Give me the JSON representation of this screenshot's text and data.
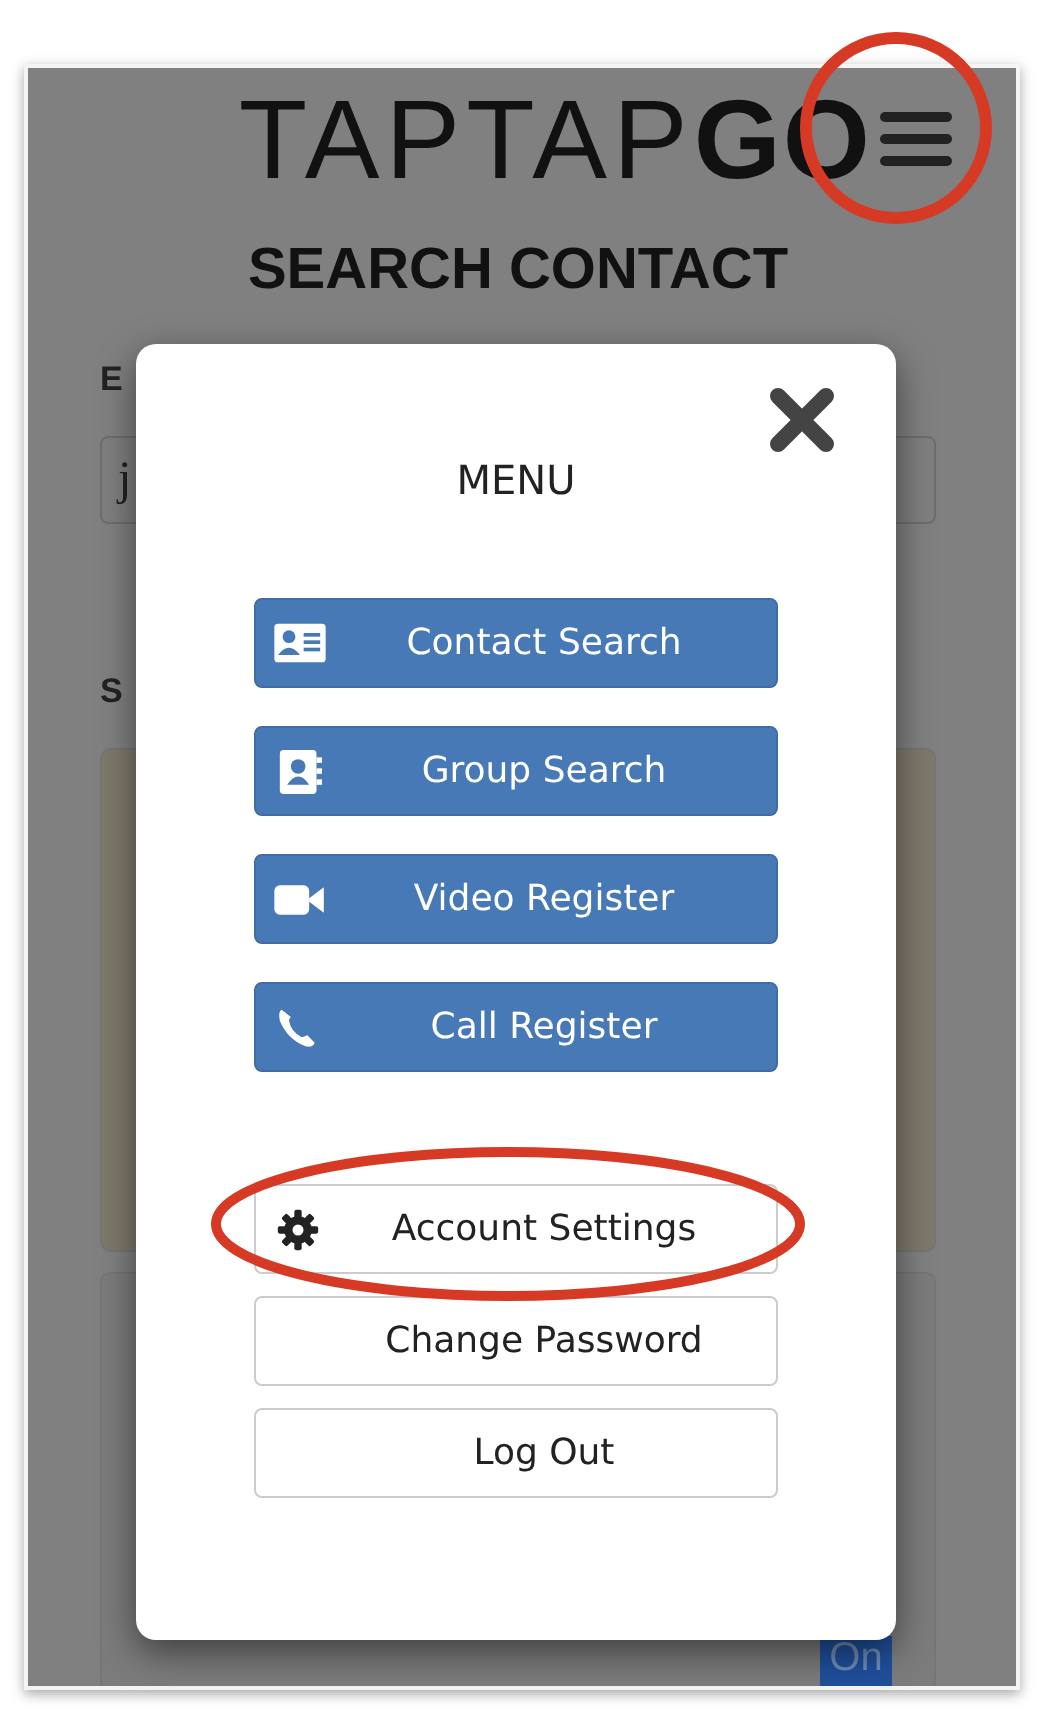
{
  "header": {
    "logo_light": "TAPTAP",
    "logo_bold": "GO"
  },
  "page_title": "SEARCH CONTACT",
  "background": {
    "field_label": "E",
    "field_value": "j",
    "section_label": "S",
    "cards": [
      {
        "highlighted": true
      },
      {
        "highlighted": false
      }
    ],
    "toggle": "On"
  },
  "menu": {
    "title": "MENU",
    "items": [
      {
        "kind": "primary",
        "label": "Contact Search"
      },
      {
        "kind": "primary",
        "label": "Group Search"
      },
      {
        "kind": "primary",
        "label": "Video Register"
      },
      {
        "kind": "primary",
        "label": "Call Register"
      },
      {
        "kind": "secondary",
        "label": "Account Settings"
      },
      {
        "kind": "secondary",
        "label": "Change Password"
      },
      {
        "kind": "secondary",
        "label": "Log Out"
      }
    ]
  }
}
